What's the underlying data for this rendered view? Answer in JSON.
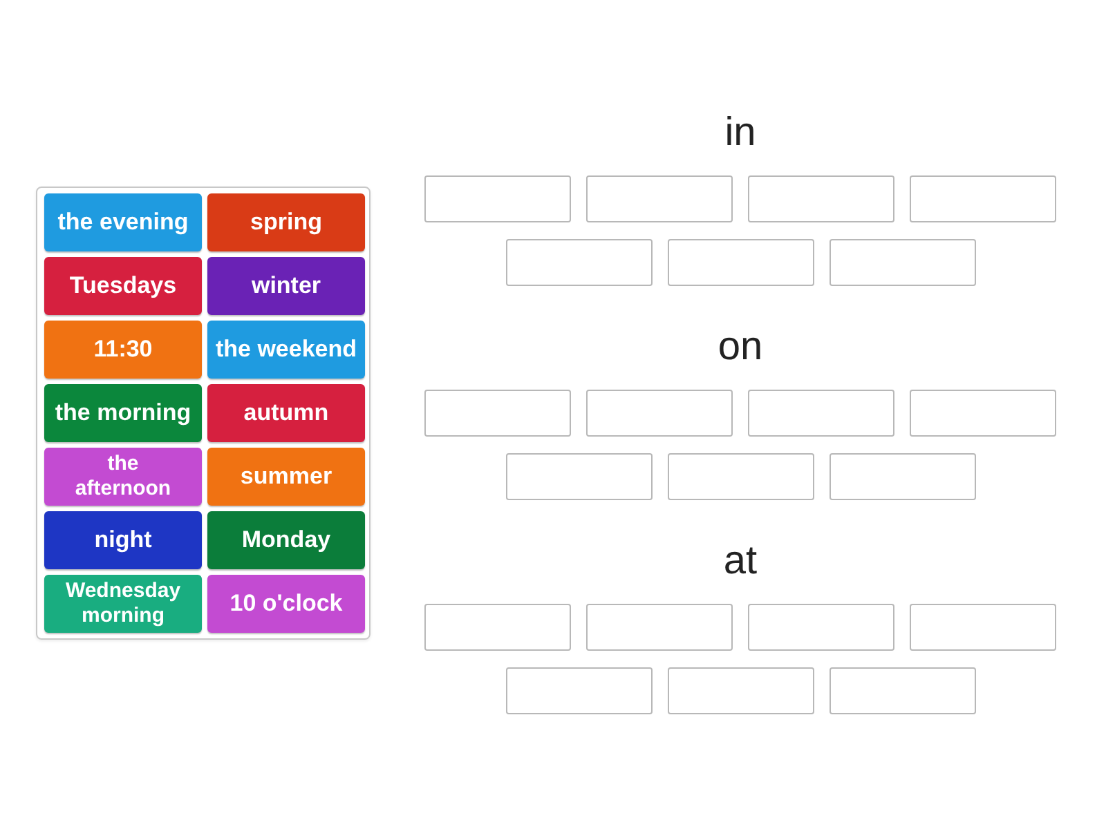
{
  "tiles": [
    {
      "label": "the evening",
      "color": "#1f9be0"
    },
    {
      "label": "spring",
      "color": "#d93b16"
    },
    {
      "label": "Tuesdays",
      "color": "#d6203f"
    },
    {
      "label": "winter",
      "color": "#6a22b5"
    },
    {
      "label": "11:30",
      "color": "#f07212"
    },
    {
      "label": "the weekend",
      "color": "#1f9be0"
    },
    {
      "label": "the morning",
      "color": "#0b873c"
    },
    {
      "label": "autumn",
      "color": "#d6203f"
    },
    {
      "label": "the afternoon",
      "color": "#c34bd2"
    },
    {
      "label": "summer",
      "color": "#f07212"
    },
    {
      "label": "night",
      "color": "#1e36c4"
    },
    {
      "label": "Monday",
      "color": "#0b7d3a"
    },
    {
      "label": "Wednesday morning",
      "color": "#19ad80"
    },
    {
      "label": "10 o'clock",
      "color": "#c34bd2"
    }
  ],
  "groups": [
    {
      "heading": "in",
      "slots": [
        {
          "kind": "empty"
        },
        {
          "kind": "empty"
        },
        {
          "kind": "empty"
        },
        {
          "kind": "empty"
        },
        {
          "kind": "empty"
        },
        {
          "kind": "empty"
        },
        {
          "kind": "empty"
        }
      ]
    },
    {
      "heading": "on",
      "slots": [
        {
          "kind": "empty"
        },
        {
          "kind": "empty"
        },
        {
          "kind": "empty"
        },
        {
          "kind": "empty"
        },
        {
          "kind": "empty"
        },
        {
          "kind": "empty"
        },
        {
          "kind": "empty"
        }
      ]
    },
    {
      "heading": "at",
      "slots": [
        {
          "kind": "empty"
        },
        {
          "kind": "empty"
        },
        {
          "kind": "empty"
        },
        {
          "kind": "empty"
        },
        {
          "kind": "empty"
        },
        {
          "kind": "empty"
        },
        {
          "kind": "empty"
        }
      ]
    }
  ]
}
